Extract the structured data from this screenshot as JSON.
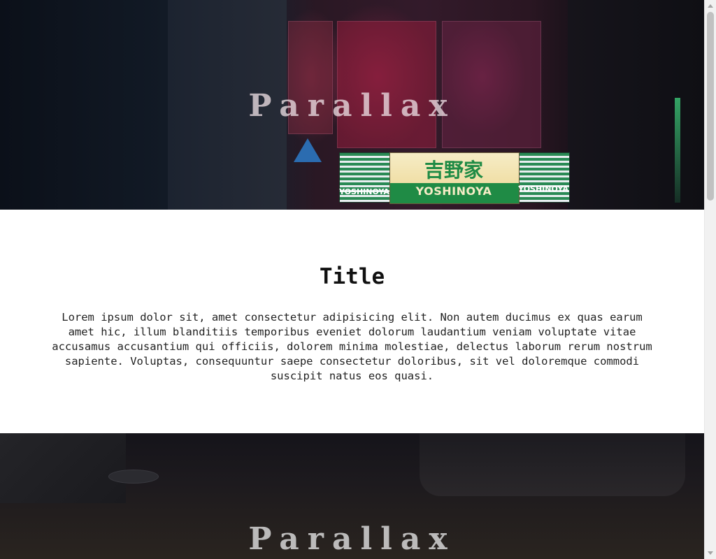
{
  "hero_top": {
    "title": "Parallax",
    "store_sign": {
      "kanji": "吉野家",
      "name": "YOSHINOYA",
      "side_left": "YOSHINOYA",
      "side_right": "YOSHINOYA"
    }
  },
  "section": {
    "title": "Title",
    "body": "Lorem ipsum dolor sit, amet consectetur adipisicing elit. Non autem ducimus ex quas earum amet hic, illum blanditiis temporibus eveniet dolorum laudantium veniam voluptate vitae accusamus accusantium qui officiis, dolorem minima molestiae, delectus laborum rerum nostrum sapiente. Voluptas, consequuntur saepe consectetur doloribus, sit vel doloremque commodi suscipit natus eos quasi."
  },
  "hero_bottom": {
    "title": "Parallax"
  },
  "colors": {
    "content_bg": "#ffffff",
    "text": "#222222",
    "store_green": "#1f8b45"
  }
}
